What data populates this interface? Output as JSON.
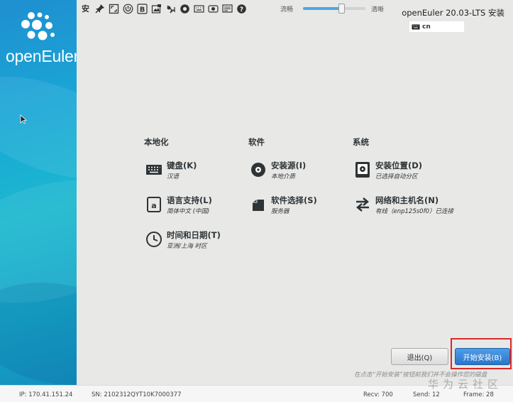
{
  "brand": {
    "name": "openEuler"
  },
  "header": {
    "window_title_fragment": "安",
    "product_title": "openEuler 20.03-LTS 安装"
  },
  "toolbar": {
    "icons": [
      "pin-icon",
      "fit-screen-icon",
      "power-icon",
      "bold-b-icon",
      "image-icon",
      "mouse-icon",
      "record-icon",
      "keyboard-icon",
      "camera-icon",
      "chat-icon",
      "help-icon"
    ],
    "quality_slider": {
      "left_label": "流畅",
      "right_label": "清晰",
      "value_percent": 62
    }
  },
  "keyboard_layout": {
    "value": "cn"
  },
  "hub": {
    "columns": [
      {
        "title": "本地化",
        "spokes": [
          {
            "icon": "keyboard-icon",
            "name": "键盘(K)",
            "status": "汉语"
          },
          {
            "icon": "language-icon",
            "name": "语言支持(L)",
            "status": "简体中文 (中国)"
          },
          {
            "icon": "clock-icon",
            "name": "时间和日期(T)",
            "status": "亚洲/上海 时区"
          }
        ]
      },
      {
        "title": "软件",
        "spokes": [
          {
            "icon": "disc-icon",
            "name": "安装源(I)",
            "status": "本地介质"
          },
          {
            "icon": "package-icon",
            "name": "软件选择(S)",
            "status": "服务器"
          }
        ]
      },
      {
        "title": "系统",
        "spokes": [
          {
            "icon": "disk-icon",
            "name": "安装位置(D)",
            "status": "已选择自动分区"
          },
          {
            "icon": "network-icon",
            "name": "网络和主机名(N)",
            "status": "有线（enp125s0f0）已连接"
          }
        ]
      }
    ]
  },
  "actions": {
    "quit_label": "退出(Q)",
    "begin_label": "开始安装(B)",
    "notice": "在点击“开始安装”按钮前我们并不会操作您的磁盘"
  },
  "status_bar": {
    "ip": "IP: 170.41.151.24",
    "sn": "SN: 2102312QYT10K7000377",
    "recv": "Recv: 700",
    "send": "Send: 12",
    "frame": "Frame: 28"
  },
  "watermark": "华为云社区",
  "colors": {
    "accent_blue": "#2a76c9",
    "sidebar_teal": "#1bb8cf",
    "highlight_red": "#d62a2a"
  }
}
